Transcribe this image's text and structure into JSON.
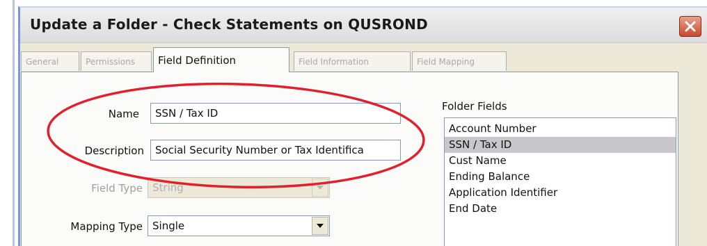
{
  "window": {
    "title": "Update a Folder - Check Statements on QUSROND"
  },
  "tabs": [
    {
      "label": "General",
      "active": false
    },
    {
      "label": "Permissions",
      "active": false
    },
    {
      "label": "Field Definition",
      "active": true
    },
    {
      "label": "Field Information",
      "active": false
    },
    {
      "label": "Field Mapping",
      "active": false
    }
  ],
  "form": {
    "name_label": "Name",
    "name_value": "SSN / Tax ID",
    "description_label": "Description",
    "description_value": "Social Security Number or Tax Identifica",
    "field_type_label": "Field Type",
    "field_type_value": "String",
    "mapping_type_label": "Mapping Type",
    "mapping_type_value": "Single"
  },
  "folder_fields": {
    "title": "Folder Fields",
    "items": [
      "Account Number",
      "SSN / Tax ID",
      "Cust Name",
      "Ending Balance",
      "Application Identifier",
      "End Date"
    ],
    "selected_index": 1
  },
  "colors": {
    "annotation_oval": "#e0202c",
    "selection": "#c8c8cc",
    "close_button": "#c84a2e"
  }
}
